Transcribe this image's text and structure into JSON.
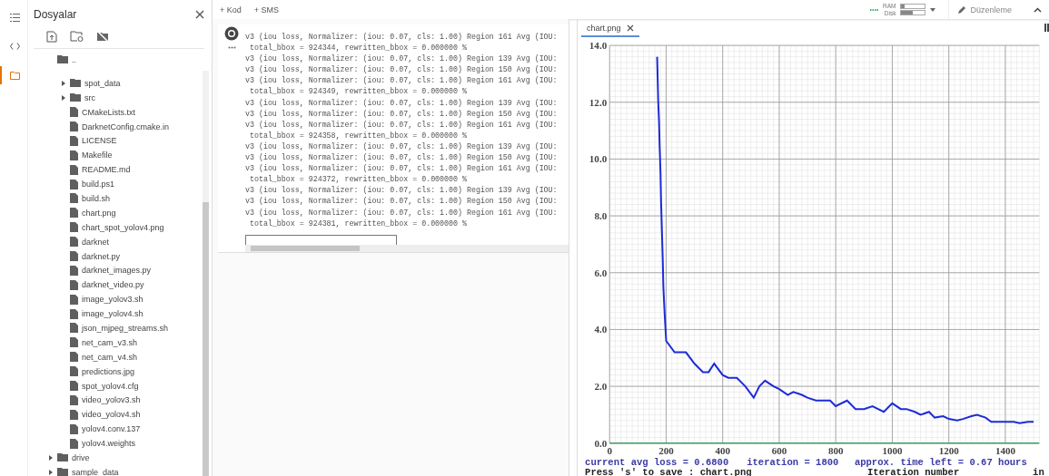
{
  "activity_bar": [
    {
      "kind": "menu",
      "selected": false
    },
    {
      "kind": "code",
      "selected": false
    },
    {
      "kind": "files",
      "selected": true
    }
  ],
  "files_panel": {
    "title": "Dosyalar",
    "parent_entry": "..",
    "tree": [
      {
        "kind": "group",
        "children": [
          {
            "kind": "folder",
            "name": "spot_data",
            "expanded": false
          },
          {
            "kind": "folder",
            "name": "src",
            "expanded": false
          },
          {
            "kind": "file",
            "name": "CMakeLists.txt"
          },
          {
            "kind": "file",
            "name": "DarknetConfig.cmake.in"
          },
          {
            "kind": "file",
            "name": "LICENSE"
          },
          {
            "kind": "file",
            "name": "Makefile"
          },
          {
            "kind": "file",
            "name": "README.md"
          },
          {
            "kind": "file",
            "name": "build.ps1"
          },
          {
            "kind": "file",
            "name": "build.sh"
          },
          {
            "kind": "file",
            "name": "chart.png"
          },
          {
            "kind": "file",
            "name": "chart_spot_yolov4.png"
          },
          {
            "kind": "file",
            "name": "darknet"
          },
          {
            "kind": "file",
            "name": "darknet.py"
          },
          {
            "kind": "file",
            "name": "darknet_images.py"
          },
          {
            "kind": "file",
            "name": "darknet_video.py"
          },
          {
            "kind": "file",
            "name": "image_yolov3.sh"
          },
          {
            "kind": "file",
            "name": "image_yolov4.sh"
          },
          {
            "kind": "file",
            "name": "json_mjpeg_streams.sh"
          },
          {
            "kind": "file",
            "name": "net_cam_v3.sh"
          },
          {
            "kind": "file",
            "name": "net_cam_v4.sh"
          },
          {
            "kind": "file",
            "name": "predictions.jpg"
          },
          {
            "kind": "file",
            "name": "spot_yolov4.cfg"
          },
          {
            "kind": "file",
            "name": "video_yolov3.sh"
          },
          {
            "kind": "file",
            "name": "video_yolov4.sh"
          },
          {
            "kind": "file",
            "name": "yolov4.conv.137"
          },
          {
            "kind": "file",
            "name": "yolov4.weights"
          }
        ]
      },
      {
        "kind": "folder",
        "name": "drive",
        "expanded": false
      },
      {
        "kind": "folder",
        "name": "sample_data",
        "expanded": false
      }
    ]
  },
  "toolbar": {
    "add_buttons": [
      "+ Kod",
      "+ SMS"
    ],
    "resources": [
      {
        "label": "RAM",
        "level": 0.15
      },
      {
        "label": "Disk",
        "level": 0.5
      }
    ],
    "edit_button": "Düzenleme"
  },
  "output": {
    "lines": [
      "v3 (iou loss, Normalizer: (iou: 0.07, cls: 1.00) Region 161 Avg (IOU:",
      " total_bbox = 924344, rewritten_bbox = 0.000000 %",
      "v3 (iou loss, Normalizer: (iou: 0.07, cls: 1.00) Region 139 Avg (IOU:",
      "v3 (iou loss, Normalizer: (iou: 0.07, cls: 1.00) Region 150 Avg (IOU:",
      "v3 (iou loss, Normalizer: (iou: 0.07, cls: 1.00) Region 161 Avg (IOU:",
      " total_bbox = 924349, rewritten_bbox = 0.000000 %",
      "v3 (iou loss, Normalizer: (iou: 0.07, cls: 1.00) Region 139 Avg (IOU:",
      "v3 (iou loss, Normalizer: (iou: 0.07, cls: 1.00) Region 150 Avg (IOU:",
      "v3 (iou loss, Normalizer: (iou: 0.07, cls: 1.00) Region 161 Avg (IOU:",
      " total_bbox = 924358, rewritten_bbox = 0.000000 %",
      "v3 (iou loss, Normalizer: (iou: 0.07, cls: 1.00) Region 139 Avg (IOU:",
      "v3 (iou loss, Normalizer: (iou: 0.07, cls: 1.00) Region 150 Avg (IOU:",
      "v3 (iou loss, Normalizer: (iou: 0.07, cls: 1.00) Region 161 Avg (IOU:",
      " total_bbox = 924372, rewritten_bbox = 0.000000 %",
      "v3 (iou loss, Normalizer: (iou: 0.07, cls: 1.00) Region 139 Avg (IOU:",
      "v3 (iou loss, Normalizer: (iou: 0.07, cls: 1.00) Region 150 Avg (IOU:",
      "v3 (iou loss, Normalizer: (iou: 0.07, cls: 1.00) Region 161 Avg (IOU:",
      " total_bbox = 924381, rewritten_bbox = 0.000000 %"
    ]
  },
  "viewer": {
    "tab": {
      "label": "chart.png",
      "selected": true
    },
    "chart_data": {
      "type": "line",
      "grid": true,
      "xlabel": "Iteration number",
      "xlim": [
        0,
        1520
      ],
      "ylim": [
        0,
        14
      ],
      "xticks": [
        0,
        200,
        400,
        600,
        800,
        1000,
        1200,
        1400
      ],
      "yticks": [
        {
          "value": 0,
          "label": "0.0"
        },
        {
          "value": 2,
          "label": "2.0"
        },
        {
          "value": 4,
          "label": "4.0"
        },
        {
          "value": 6,
          "label": "6.0"
        },
        {
          "value": 8,
          "label": "8.0"
        },
        {
          "value": 10,
          "label": "10.0"
        },
        {
          "value": 12,
          "label": "12.0"
        },
        {
          "value": 14,
          "label": "14.0"
        }
      ],
      "x": [
        168,
        170,
        172,
        175,
        177,
        180,
        182,
        185,
        188,
        190,
        195,
        200,
        230,
        250,
        270,
        300,
        330,
        350,
        370,
        400,
        420,
        450,
        480,
        510,
        530,
        550,
        580,
        600,
        630,
        650,
        680,
        700,
        730,
        750,
        780,
        800,
        840,
        870,
        900,
        930,
        950,
        970,
        1000,
        1030,
        1050,
        1080,
        1100,
        1130,
        1150,
        1180,
        1200,
        1230,
        1250,
        1280,
        1300,
        1330,
        1350,
        1380,
        1400,
        1430,
        1450,
        1480,
        1500
      ],
      "series": [
        {
          "color": "#1e2bd8",
          "values": [
            13.6,
            12.8,
            12.0,
            11.3,
            10.5,
            9.5,
            8.5,
            7.5,
            6.5,
            5.5,
            4.5,
            3.6,
            3.2,
            3.2,
            3.2,
            2.8,
            2.5,
            2.5,
            2.8,
            2.4,
            2.3,
            2.3,
            2.0,
            1.6,
            2.0,
            2.2,
            2.0,
            1.9,
            1.7,
            1.8,
            1.7,
            1.6,
            1.5,
            1.5,
            1.5,
            1.3,
            1.5,
            1.2,
            1.2,
            1.3,
            1.2,
            1.1,
            1.4,
            1.2,
            1.2,
            1.1,
            1.0,
            1.1,
            0.9,
            0.95,
            0.85,
            0.8,
            0.85,
            0.95,
            1.0,
            0.9,
            0.75,
            0.75,
            0.75,
            0.75,
            0.7,
            0.75,
            0.75
          ]
        }
      ]
    },
    "chart_status": [
      "current avg loss = 0.6800",
      "iteration = 1800",
      "approx. time left = 0.67 hours"
    ],
    "chart_hint": "Press 's' to save : chart.png",
    "chart_xlabel_cut": "in"
  }
}
